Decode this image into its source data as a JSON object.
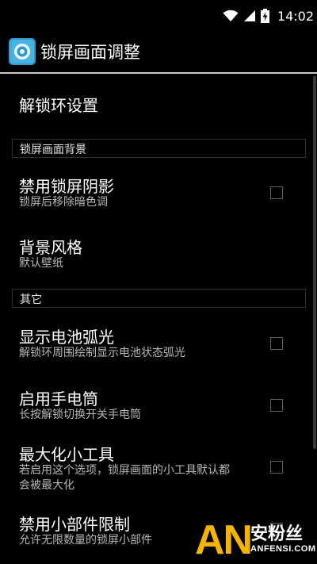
{
  "status_bar": {
    "time": "14:02",
    "icons": [
      "wifi-icon",
      "signal-icon",
      "battery-charging-icon"
    ]
  },
  "action_bar": {
    "icon": "app-settings-icon",
    "title": "锁屏画面调整"
  },
  "items": {
    "unlock_ring": {
      "title": "解锁环设置"
    },
    "section_background": {
      "label": "锁屏画面背景"
    },
    "disable_shadow": {
      "title": "禁用锁屏阴影",
      "summary": "锁屏后移除暗色调",
      "checked": false
    },
    "background_style": {
      "title": "背景风格",
      "summary": "默认壁纸"
    },
    "section_other": {
      "label": "其它"
    },
    "battery_arc": {
      "title": "显示电池弧光",
      "summary": "解锁环周围绘制显示电池状态弧光",
      "checked": false
    },
    "flashlight": {
      "title": "启用手电筒",
      "summary": "长按解锁切换开关手电筒",
      "checked": false
    },
    "maximize_widgets": {
      "title": "最大化小工具",
      "summary_line1": "若启用这个选项，锁屏画面的小工具默认都",
      "summary_line2": "会被最大化",
      "checked": false
    },
    "disable_widget_limit": {
      "title": "禁用小部件限制",
      "summary": "允许无限数量的锁屏小部件",
      "checked": false
    }
  },
  "watermark": {
    "logo": "AN",
    "brand": "安粉丝",
    "url": "ANFENSI.COM"
  },
  "colors": {
    "background": "#000000",
    "divider": "#c9c9c9",
    "summary_text": "#b7b7b7",
    "watermark_accent": "#f4b400"
  }
}
